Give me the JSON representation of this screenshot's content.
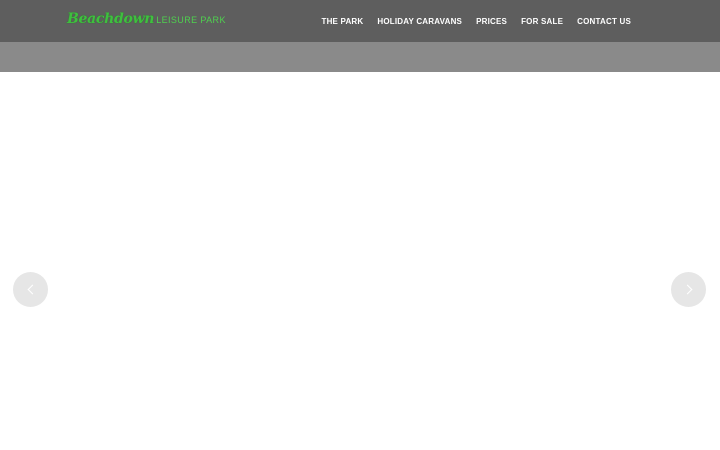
{
  "header": {
    "logo": {
      "script_text": "Beachdown",
      "sub_text": "LEISURE PARK",
      "color": "#3fbf3f"
    },
    "nav": [
      {
        "label": "THE PARK"
      },
      {
        "label": "HOLIDAY CARAVANS"
      },
      {
        "label": "PRICES"
      },
      {
        "label": "FOR SALE"
      },
      {
        "label": "CONTACT US"
      }
    ],
    "background_color": "#5e5e5e",
    "subbar_color": "#8a8a8a"
  },
  "slider": {
    "prev_icon": "chevron-left-icon",
    "next_icon": "chevron-right-icon"
  }
}
